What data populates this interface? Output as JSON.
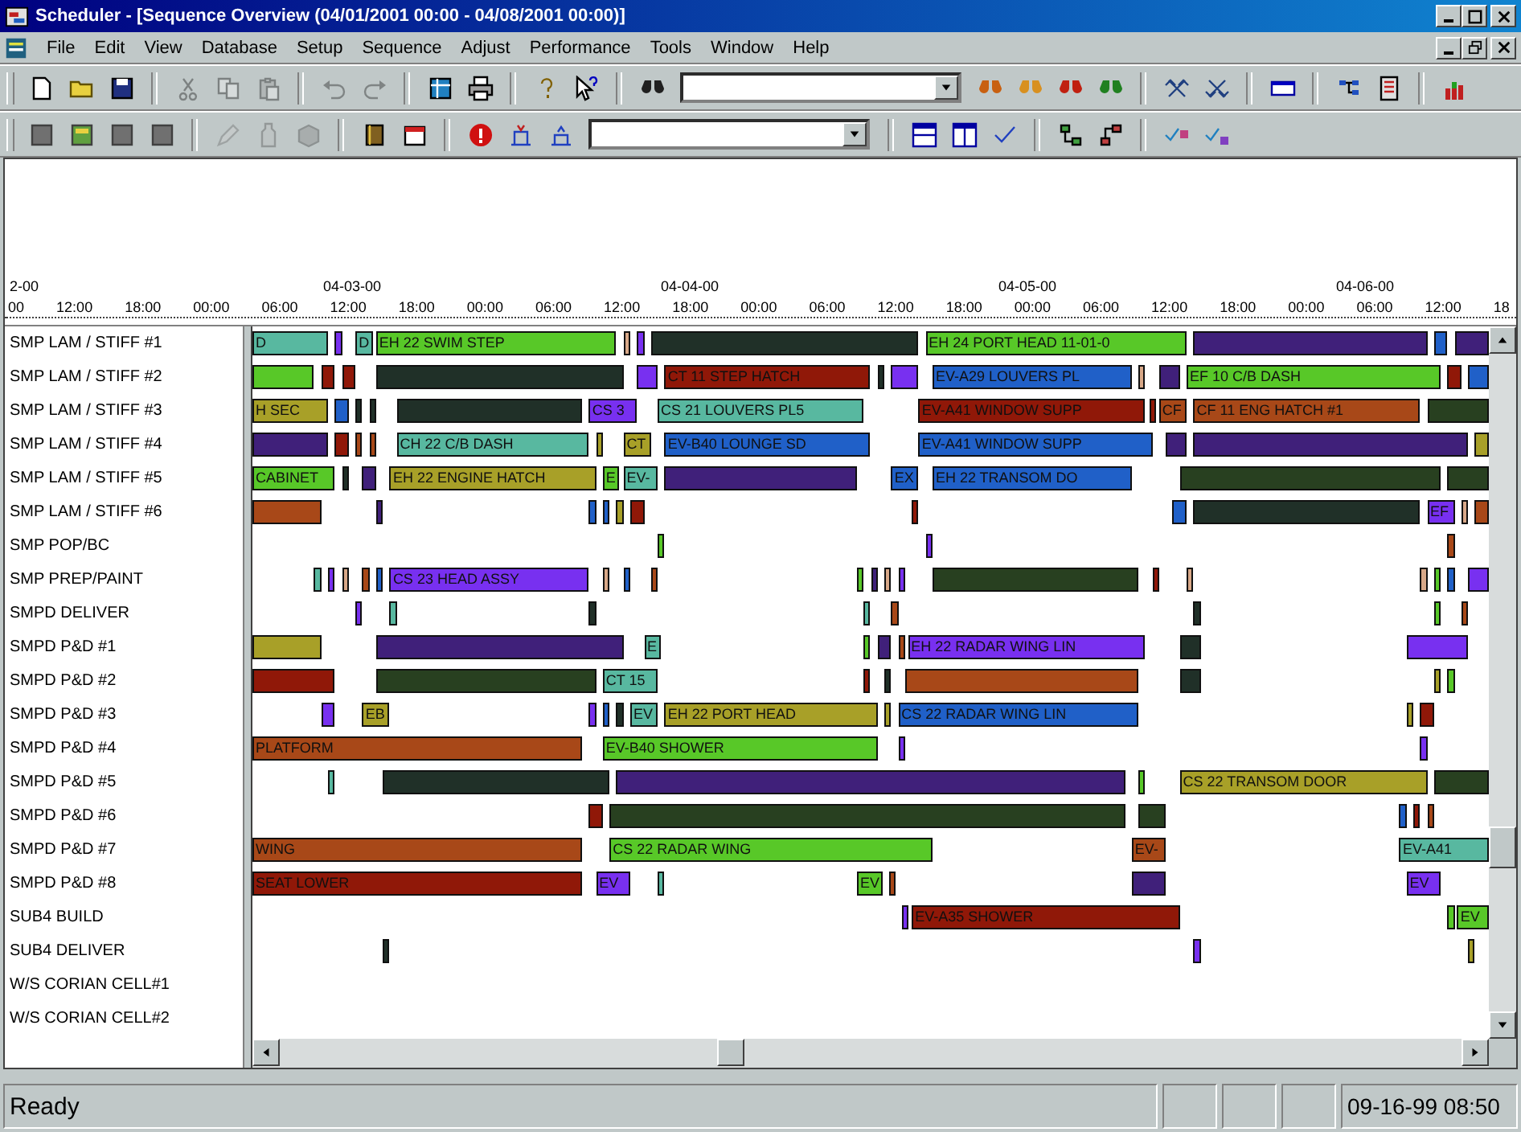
{
  "window": {
    "title": "Scheduler - [Sequence Overview (04/01/2001 00:00 - 04/08/2001 00:00)]"
  },
  "menu": [
    "File",
    "Edit",
    "View",
    "Database",
    "Setup",
    "Sequence",
    "Adjust",
    "Performance",
    "Tools",
    "Window",
    "Help"
  ],
  "toolbars": [
    {
      "buttons": [
        {
          "disabled": false
        },
        {
          "disabled": false
        },
        {
          "disabled": false
        },
        {
          "disabled": true
        },
        {
          "disabled": true
        },
        {
          "disabled": true
        },
        {
          "disabled": true
        },
        {
          "disabled": true
        },
        {
          "disabled": false
        },
        {
          "disabled": false
        },
        {
          "disabled": false
        },
        {
          "disabled": false
        },
        {
          "disabled": false
        },
        {
          "disabled": false
        },
        {
          "disabled": false
        },
        {
          "disabled": false
        },
        {
          "disabled": false
        },
        {
          "disabled": false
        },
        {
          "disabled": false
        },
        {
          "disabled": false
        },
        {
          "disabled": false
        },
        {
          "disabled": false
        },
        {
          "disabled": false
        }
      ]
    },
    {
      "buttons": [
        {
          "disabled": false
        },
        {
          "disabled": false
        },
        {
          "disabled": false
        },
        {
          "disabled": false
        },
        {
          "disabled": true
        },
        {
          "disabled": true
        },
        {
          "disabled": true
        },
        {
          "disabled": false
        },
        {
          "disabled": false
        },
        {
          "disabled": false
        },
        {
          "disabled": false
        },
        {
          "disabled": false
        },
        {
          "disabled": false
        },
        {
          "disabled": false
        },
        {
          "disabled": false
        },
        {
          "disabled": false
        },
        {
          "disabled": false
        },
        {
          "disabled": false
        },
        {
          "disabled": false
        }
      ]
    }
  ],
  "timeline": {
    "dates": [
      "2-00",
      "04-03-00",
      "04-04-00",
      "04-05-00",
      "04-06-00"
    ],
    "times": [
      "00",
      "12:00",
      "18:00",
      "00:00",
      "06:00",
      "12:00",
      "18:00",
      "00:00",
      "06:00",
      "12:00",
      "18:00",
      "00:00",
      "06:00",
      "12:00",
      "18:00",
      "00:00",
      "06:00",
      "12:00",
      "18:00",
      "00:00",
      "06:00",
      "12:00",
      "18"
    ]
  },
  "rows": [
    {
      "name": "SMP LAM / STIFF #1",
      "bars": [
        {
          "color": "#58b8a0",
          "label": "D"
        },
        {
          "color": "#7830f0"
        },
        {
          "color": "#58b8a0",
          "label": "D"
        },
        {
          "color": "#58c828",
          "label": "EH 22 SWIM STEP"
        },
        {
          "color": "#d8a888"
        },
        {
          "color": "#7830f0"
        },
        {
          "color": "#203028"
        },
        {
          "color": "#58c828",
          "label": "EH 24 PORT HEAD 11-01-0"
        },
        {
          "color": "#40207a"
        },
        {
          "color": "#2060c8"
        },
        {
          "color": "#40207a"
        }
      ]
    },
    {
      "name": "SMP LAM / STIFF #2",
      "bars": [
        {
          "color": "#58c828"
        },
        {
          "color": "#901808"
        },
        {
          "color": "#901808"
        },
        {
          "color": "#203028"
        },
        {
          "color": "#7830f0"
        },
        {
          "color": "#901808",
          "label": "CT 11 STEP HATCH"
        },
        {
          "color": "#203028"
        },
        {
          "color": "#7830f0"
        },
        {
          "color": "#2060c8",
          "label": "EV-A29 LOUVERS PL"
        },
        {
          "color": "#d8a888"
        },
        {
          "color": "#40207a"
        },
        {
          "color": "#58c828",
          "label": "EF 10 C/B DASH"
        },
        {
          "color": "#901808"
        },
        {
          "color": "#2060c8"
        }
      ]
    },
    {
      "name": "SMP LAM / STIFF #3",
      "bars": [
        {
          "color": "#a8a028",
          "label": "H SEC"
        },
        {
          "color": "#2060c8"
        },
        {
          "color": "#203028"
        },
        {
          "color": "#203028"
        },
        {
          "color": "#203028"
        },
        {
          "color": "#7830f0",
          "label": "CS 3"
        },
        {
          "color": "#58b8a0",
          "label": "CS 21 LOUVERS PL5"
        },
        {
          "color": "#901808",
          "label": "EV-A41 WINDOW SUPP"
        },
        {
          "color": "#901808"
        },
        {
          "color": "#a84818",
          "label": "CF"
        },
        {
          "color": "#a84818",
          "label": "CF 11 ENG HATCH #1"
        },
        {
          "color": "#284020"
        }
      ]
    },
    {
      "name": "SMP LAM / STIFF #4",
      "bars": [
        {
          "color": "#40207a"
        },
        {
          "color": "#901808"
        },
        {
          "color": "#a84818"
        },
        {
          "color": "#a84818"
        },
        {
          "color": "#58b8a0",
          "label": "CH 22 C/B DASH"
        },
        {
          "color": "#a8a028"
        },
        {
          "color": "#a8a028",
          "label": "CT"
        },
        {
          "color": "#2060c8",
          "label": "EV-B40 LOUNGE SD"
        },
        {
          "color": "#2060c8",
          "label": "EV-A41 WINDOW SUPP"
        },
        {
          "color": "#40207a"
        },
        {
          "color": "#40207a"
        },
        {
          "color": "#a8a028"
        }
      ]
    },
    {
      "name": "SMP LAM / STIFF #5",
      "bars": [
        {
          "color": "#58c828",
          "label": "CABINET"
        },
        {
          "color": "#203028"
        },
        {
          "color": "#40207a"
        },
        {
          "color": "#a8a028",
          "label": "EH 22 ENGINE HATCH"
        },
        {
          "color": "#58c828",
          "label": "E"
        },
        {
          "color": "#58b8a0",
          "label": "EV-"
        },
        {
          "color": "#40207a"
        },
        {
          "color": "#2060c8",
          "label": "EX"
        },
        {
          "color": "#2060c8",
          "label": "EH 22 TRANSOM DO"
        },
        {
          "color": "#284020"
        },
        {
          "color": "#284020"
        }
      ]
    },
    {
      "name": "SMP LAM / STIFF #6",
      "bars": [
        {
          "color": "#a84818"
        },
        {
          "color": "#40207a"
        },
        {
          "color": "#2060c8"
        },
        {
          "color": "#2060c8"
        },
        {
          "color": "#a8a028"
        },
        {
          "color": "#901808"
        },
        {
          "color": "#901808"
        },
        {
          "color": "#2060c8"
        },
        {
          "color": "#203028"
        },
        {
          "color": "#7830f0",
          "label": "EF"
        },
        {
          "color": "#d8a888"
        },
        {
          "color": "#a84818"
        }
      ]
    },
    {
      "name": "SMP POP/BC",
      "bars": [
        {
          "color": "#58c828"
        },
        {
          "color": "#7830f0"
        },
        {
          "color": "#a84818"
        }
      ]
    },
    {
      "name": "SMP PREP/PAINT",
      "bars": [
        {
          "color": "#58b8a0"
        },
        {
          "color": "#7830f0"
        },
        {
          "color": "#d8a888"
        },
        {
          "color": "#a84818"
        },
        {
          "color": "#2060c8"
        },
        {
          "color": "#7830f0",
          "label": "CS 23 HEAD ASSY"
        },
        {
          "color": "#d8a888"
        },
        {
          "color": "#2060c8"
        },
        {
          "color": "#a84818"
        },
        {
          "color": "#58c828"
        },
        {
          "color": "#40207a"
        },
        {
          "color": "#d8a888"
        },
        {
          "color": "#7830f0"
        },
        {
          "color": "#284020"
        },
        {
          "color": "#901808"
        },
        {
          "color": "#d8a888"
        },
        {
          "color": "#d8a888"
        },
        {
          "color": "#58c828"
        },
        {
          "color": "#2060c8"
        },
        {
          "color": "#7830f0"
        }
      ]
    },
    {
      "name": "SMPD DELIVER",
      "bars": [
        {
          "color": "#7830f0"
        },
        {
          "color": "#58b8a0"
        },
        {
          "color": "#203028"
        },
        {
          "color": "#58b8a0"
        },
        {
          "color": "#a84818"
        },
        {
          "color": "#203028"
        },
        {
          "color": "#58c828"
        },
        {
          "color": "#a84818"
        }
      ]
    },
    {
      "name": "SMPD P&D #1",
      "bars": [
        {
          "color": "#a8a028"
        },
        {
          "color": "#40207a"
        },
        {
          "color": "#58b8a0",
          "label": "E"
        },
        {
          "color": "#58c828"
        },
        {
          "color": "#40207a"
        },
        {
          "color": "#a84818"
        },
        {
          "color": "#7830f0",
          "label": "EH 22 RADAR WING LIN"
        },
        {
          "color": "#203028"
        },
        {
          "color": "#7830f0"
        }
      ]
    },
    {
      "name": "SMPD P&D #2",
      "bars": [
        {
          "color": "#901808"
        },
        {
          "color": "#284020"
        },
        {
          "color": "#58b8a0",
          "label": "CT 15"
        },
        {
          "color": "#901808"
        },
        {
          "color": "#203028"
        },
        {
          "color": "#a84818"
        },
        {
          "color": "#203028"
        },
        {
          "color": "#a8a028"
        },
        {
          "color": "#58c828"
        }
      ]
    },
    {
      "name": "SMPD P&D #3",
      "bars": [
        {
          "color": "#7830f0"
        },
        {
          "color": "#a8a028",
          "label": "EB"
        },
        {
          "color": "#7830f0"
        },
        {
          "color": "#2060c8"
        },
        {
          "color": "#203028"
        },
        {
          "color": "#58b8a0",
          "label": "EV"
        },
        {
          "color": "#a8a028",
          "label": "EH 22 PORT HEAD"
        },
        {
          "color": "#a8a028"
        },
        {
          "color": "#2060c8",
          "label": "CS 22 RADAR WING LIN"
        },
        {
          "color": "#a8a028"
        },
        {
          "color": "#901808"
        }
      ]
    },
    {
      "name": "SMPD P&D #4",
      "bars": [
        {
          "color": "#a84818",
          "label": "PLATFORM"
        },
        {
          "color": "#58c828",
          "label": "EV-B40 SHOWER"
        },
        {
          "color": "#7830f0"
        },
        {
          "color": "#7830f0"
        }
      ]
    },
    {
      "name": "SMPD P&D #5",
      "bars": [
        {
          "color": "#58b8a0"
        },
        {
          "color": "#203028"
        },
        {
          "color": "#40207a"
        },
        {
          "color": "#58c828"
        },
        {
          "color": "#a8a028",
          "label": "CS 22 TRANSOM DOOR"
        },
        {
          "color": "#284020"
        }
      ]
    },
    {
      "name": "SMPD P&D #6",
      "bars": [
        {
          "color": "#901808"
        },
        {
          "color": "#284020"
        },
        {
          "color": "#284020"
        },
        {
          "color": "#2060c8"
        },
        {
          "color": "#901808"
        },
        {
          "color": "#a84818"
        }
      ]
    },
    {
      "name": "SMPD P&D #7",
      "bars": [
        {
          "color": "#a84818",
          "label": "WING"
        },
        {
          "color": "#58c828",
          "label": "CS 22 RADAR WING"
        },
        {
          "color": "#a84818",
          "label": "EV-"
        },
        {
          "color": "#58b8a0",
          "label": "EV-A41"
        }
      ]
    },
    {
      "name": "SMPD P&D #8",
      "bars": [
        {
          "color": "#901808",
          "label": "SEAT LOWER"
        },
        {
          "color": "#7830f0",
          "label": "EV"
        },
        {
          "color": "#58b8a0"
        },
        {
          "color": "#58c828",
          "label": "EV"
        },
        {
          "color": "#a84818"
        },
        {
          "color": "#40207a"
        },
        {
          "color": "#7830f0",
          "label": "EV"
        }
      ]
    },
    {
      "name": "SUB4 BUILD",
      "bars": [
        {
          "color": "#7830f0"
        },
        {
          "color": "#901808",
          "label": "EV-A35 SHOWER"
        },
        {
          "color": "#58c828"
        },
        {
          "color": "#58c828",
          "label": "EV"
        }
      ]
    },
    {
      "name": "SUB4 DELIVER",
      "bars": [
        {
          "color": "#203028"
        },
        {
          "color": "#7830f0"
        },
        {
          "color": "#a8a028"
        }
      ]
    },
    {
      "name": "W/S CORIAN CELL#1"
    },
    {
      "name": "W/S CORIAN CELL#2"
    }
  ],
  "status_bar": {
    "message": "Ready",
    "datetime": "09-16-99 08:50"
  }
}
